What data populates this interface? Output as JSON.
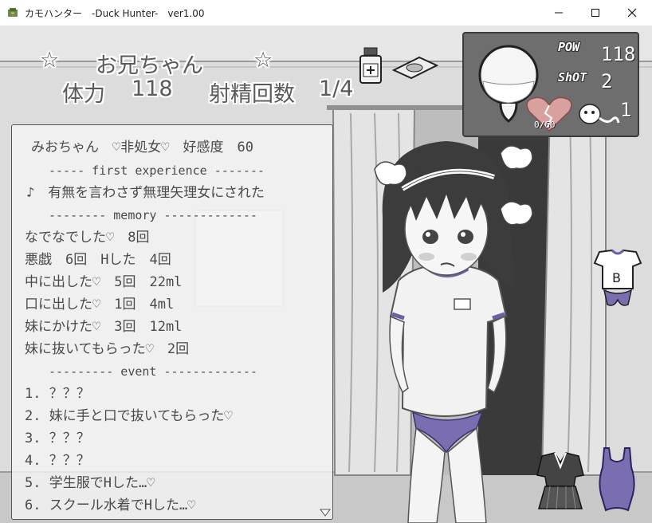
{
  "window": {
    "title": "カモハンター　-Duck Hunter-　ver1.00",
    "icon": "game-app-icon",
    "buttons": [
      "minimize-icon",
      "maximize-icon",
      "close-icon"
    ]
  },
  "header": {
    "stars_left": "☆",
    "name": "お兄ちゃん",
    "stars_right": "☆",
    "stamina_label": "体力",
    "stamina_value": "118",
    "count_label": "射精回数",
    "count_value": "1/4"
  },
  "items": [
    "medicine-bottle-icon",
    "pill-tray-icon"
  ],
  "status": {
    "pow_label": "POW",
    "pow_value": "118",
    "shot_label": "ShOT",
    "shot_value": "2",
    "heart_value": "0/60",
    "ghost_value": "1",
    "gauge_icon": "flask-gauge-icon",
    "heart_icon": "broken-heart-icon",
    "ghost_icon": "sperm-ghost-icon"
  },
  "log": {
    "header": "みおちゃん　♡非処女♡　好感度　60",
    "sep_first": "----- first experience -------",
    "first_exp": "♪　有無を言わさず無理矢理女にされた",
    "sep_memory": "-------- memory -------------",
    "memory": [
      "なでなでした♡　8回",
      "悪戯　6回　Hした　4回",
      "中に出した♡　5回　22ml",
      "口に出した♡　1回　4ml",
      "妹にかけた♡　3回　12ml",
      "妹に抜いてもらった♡　2回"
    ],
    "sep_event": "--------- event -------------",
    "events": [
      "1. ？？？",
      "2. 妹に手と口で抜いてもらった♡",
      "3. ？？？",
      "4. ？？？",
      "5. 学生服でHした…♡",
      "6. スクール水着でHした…♡"
    ]
  },
  "costumes": [
    "gym-uniform-icon",
    "sailor-uniform-icon",
    "school-swimsuit-icon"
  ],
  "colors": {
    "panel": "#6e6e6e",
    "heart": "#d9a0a0",
    "uniform_accent": "#7a6db0",
    "text": "#4a4a4a"
  }
}
